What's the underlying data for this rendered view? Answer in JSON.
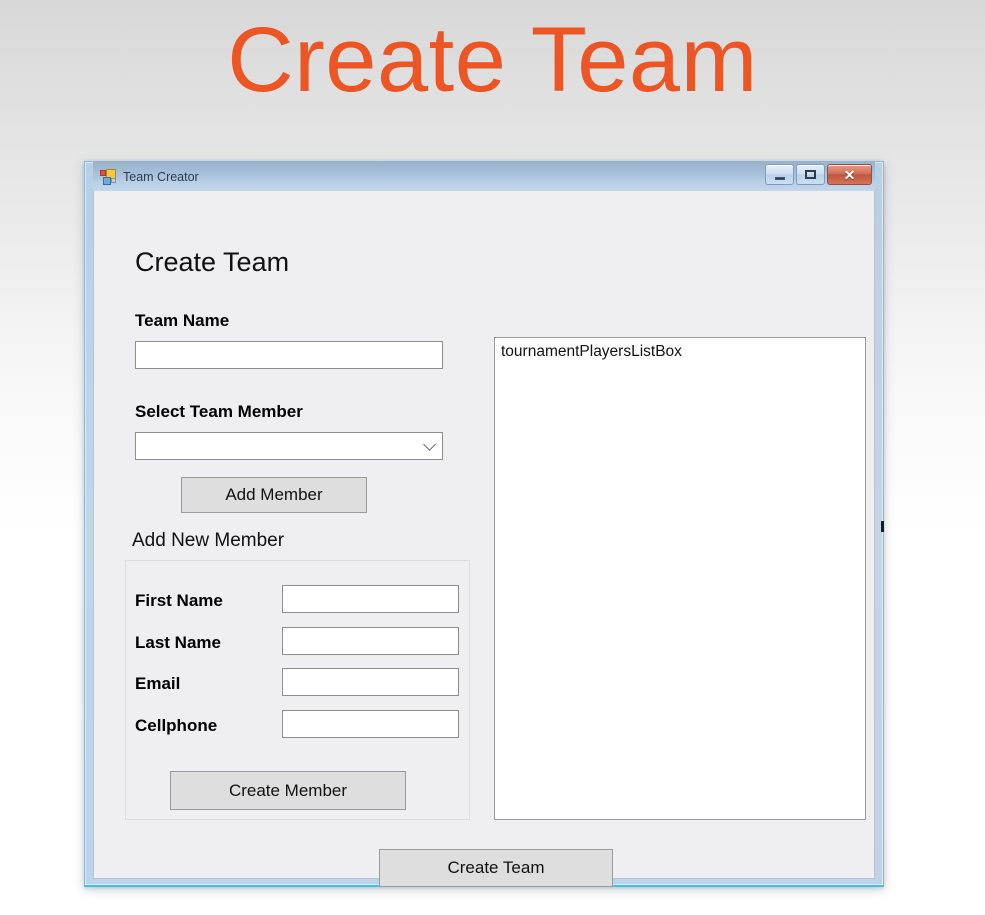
{
  "slide": {
    "title": "Create Team",
    "title_color": "#ee5524"
  },
  "window": {
    "titlebar": {
      "title": "Team Creator",
      "icon": "winforms-app-icon",
      "buttons": {
        "minimize": "─",
        "maximize": "□",
        "close": "✕"
      }
    },
    "form": {
      "heading": "Create Team",
      "fields": {
        "team_name_label": "Team Name",
        "team_name_value": "",
        "select_team_member_label": "Select Team Member",
        "select_team_member_value": "",
        "select_team_member_arrow": "chevron-down"
      },
      "buttons": {
        "add_member": "Add Member",
        "create_member": "Create Member",
        "create_team": "Create Team"
      },
      "group": {
        "legend": "Add New Member",
        "rows": [
          {
            "label": "First Name",
            "value": ""
          },
          {
            "label": "Last Name",
            "value": ""
          },
          {
            "label": "Email",
            "value": ""
          },
          {
            "label": "Cellphone",
            "value": ""
          }
        ]
      },
      "listbox": {
        "name": "tournamentPlayersListBox",
        "items": [
          "tournamentPlayersListBox"
        ]
      }
    }
  }
}
